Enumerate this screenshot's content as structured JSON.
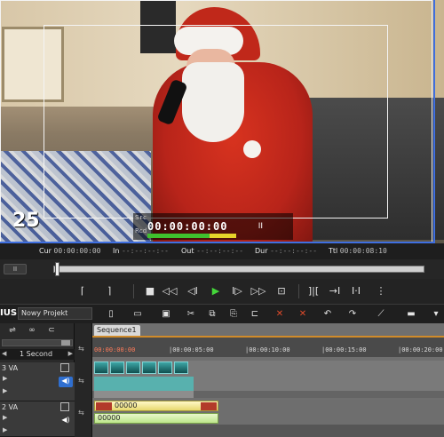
{
  "preview": {
    "frame_number": "25",
    "overlay": {
      "src_label": "Src",
      "rec_label": "Rcd",
      "timecode": "00:00:00:00",
      "pause_glyph": "II"
    }
  },
  "timecode_bar": {
    "cur_label": "Cur",
    "cur_value": "00:00:00:00",
    "in_label": "In",
    "in_value": "--:--:--:--",
    "out_label": "Out",
    "out_value": "--:--:--:--",
    "dur_label": "Dur",
    "dur_value": "--:--:--:--",
    "ttl_label": "Ttl",
    "ttl_value": "00:00:08:10"
  },
  "scrub": {
    "pause_label": "II"
  },
  "transport": {
    "buttons": [
      "⌈",
      "⌉",
      "■",
      "◁◁",
      "◁I",
      "▶",
      "I▷",
      "▷▷",
      "⊡",
      "]|[",
      "→I",
      "I·I",
      "⋮"
    ]
  },
  "toolbar": {
    "app_label": "IUS",
    "project_name": "Nowy Projekt"
  },
  "left_panel": {
    "scale_label": "1 Second",
    "tracks": [
      {
        "name": "3 VA"
      },
      {
        "name": "2 VA"
      }
    ]
  },
  "timeline": {
    "sequence_tab": "Sequence1",
    "ruler": [
      "00:00:00:00",
      "|00:00:05:00",
      "|00:00:10:00",
      "|00:00:15:00",
      "|00:00:20:00"
    ],
    "clips": {
      "v2_video_label": "00000",
      "v2_audio_label": "00000"
    }
  },
  "colors": {
    "play_button": "#44d63a",
    "active_audio": "#2f6fd0",
    "sequence_accent": "#d08b2a",
    "video_clip": "#e7d86e",
    "audio_clip": "#bde68b",
    "teal_clip": "#58b1ae"
  }
}
